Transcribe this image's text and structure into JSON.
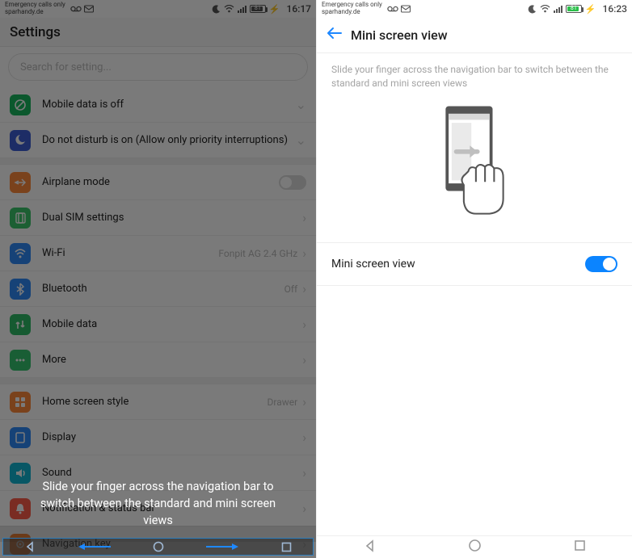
{
  "left": {
    "status": {
      "carrier_line1": "Emergency calls only",
      "carrier_line2": "sparhandy.de",
      "battery_pct": "81",
      "clock": "16:17"
    },
    "title": "Settings",
    "search_placeholder": "Search for setting...",
    "rows": {
      "mobile_data_off": "Mobile data is off",
      "dnd": "Do not disturb is on (Allow only priority interruptions)",
      "airplane": "Airplane mode",
      "dual_sim": "Dual SIM settings",
      "wifi": "Wi-Fi",
      "wifi_value": "Fonpit AG 2.4 GHz",
      "bluetooth": "Bluetooth",
      "bluetooth_value": "Off",
      "mobile_data": "Mobile data",
      "more": "More",
      "home_style": "Home screen style",
      "home_style_value": "Drawer",
      "display": "Display",
      "sound": "Sound",
      "notif_status": "Notification & status bar",
      "nav_key": "Navigation key"
    },
    "toast": "Slide your finger across the navigation bar to switch between the standard and mini screen views"
  },
  "right": {
    "status": {
      "carrier_line1": "Emergency calls only",
      "carrier_line2": "sparhandy.de",
      "battery_pct": "81",
      "clock": "16:23"
    },
    "title": "Mini screen view",
    "description": "Slide your finger across the navigation bar to switch between the standard and mini screen views",
    "toggle_label": "Mini screen view"
  },
  "icons": {
    "mobile_data_off": "#18b85e",
    "dnd": "#3d5fd6",
    "airplane": "#ff8a3b",
    "dual_sim": "#3bc76b",
    "wifi": "#2f8af9",
    "bluetooth": "#2f8af9",
    "mobile_data": "#2fbc67",
    "more": "#35c46f",
    "home_style": "#ff8a3b",
    "display": "#2f8af9",
    "sound": "#12b6d4",
    "notif_status": "#ff5d4a",
    "nav_key": "#ff8a3b"
  }
}
